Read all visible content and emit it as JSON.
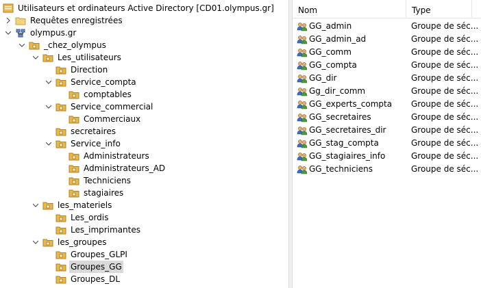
{
  "tree": {
    "root": "Utilisateurs et ordinateurs Active Directory [CD01.olympus.gr]",
    "saved_queries": "Requêtes enregistrées",
    "domain": "olympus.gr",
    "chez": "_chez_olympus",
    "les_utilisateurs": "Les_utilisateurs",
    "direction": "Direction",
    "service_compta": "Service_compta",
    "comptables": "comptables",
    "service_commercial": "Service_commercial",
    "commerciaux": "Commerciaux",
    "secretaires": "secretaires",
    "service_info": "Service_info",
    "administrateurs": "Administrateurs",
    "administrateurs_ad": "Administrateurs_AD",
    "techniciens": "Techniciens",
    "stagiaires": "stagiaires",
    "les_materiels": "les_materiels",
    "les_ordis": "Les_ordis",
    "les_imprimantes": "Les_imprimantes",
    "les_groupes": "les_groupes",
    "groupes_glpi": "Groupes_GLPI",
    "groupes_gg": "Groupes_GG",
    "groupes_dl": "Groupes_DL"
  },
  "list": {
    "col_name": "Nom",
    "col_type": "Type",
    "rows": [
      {
        "name": "GG_admin",
        "type": "Groupe de séc..."
      },
      {
        "name": "GG_admin_ad",
        "type": "Groupe de séc..."
      },
      {
        "name": "GG_comm",
        "type": "Groupe de séc..."
      },
      {
        "name": "GG_compta",
        "type": "Groupe de séc..."
      },
      {
        "name": "GG_dir",
        "type": "Groupe de séc..."
      },
      {
        "name": "Gg_dir_comm",
        "type": "Groupe de séc..."
      },
      {
        "name": "GG_experts_compta",
        "type": "Groupe de séc..."
      },
      {
        "name": "GG_secretaires",
        "type": "Groupe de séc..."
      },
      {
        "name": "GG_secretaires_dir",
        "type": "Groupe de séc..."
      },
      {
        "name": "GG_stag_compta",
        "type": "Groupe de séc..."
      },
      {
        "name": "GG_stagiaires_info",
        "type": "Groupe de séc..."
      },
      {
        "name": "GG_techniciens",
        "type": "Groupe de séc..."
      }
    ]
  },
  "icons": {
    "folder": "folder-icon",
    "ou": "organizational-unit-icon",
    "group": "group-icon",
    "domain": "domain-icon",
    "console": "ad-console-icon"
  },
  "colors": {
    "folder_yellow": "#e8b84a",
    "selection": "#d9d9d9",
    "group_blue": "#3a6fbf",
    "group_green": "#4a9a3a"
  }
}
